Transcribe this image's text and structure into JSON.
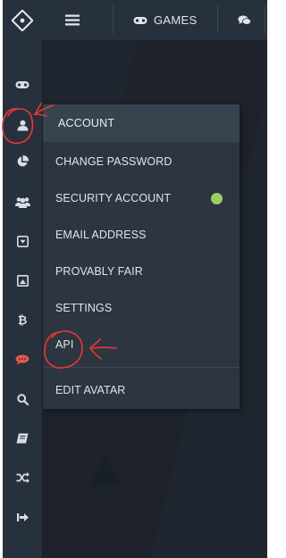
{
  "topbar": {
    "games_label": "GAMES"
  },
  "sidebar": {
    "icons": [
      "logo-icon",
      "gamepad-icon",
      "user-icon",
      "pie-chart-icon",
      "users-icon",
      "caret-square-down-icon",
      "image-icon",
      "bitcoin-icon",
      "chat-icon",
      "search-icon",
      "book-icon",
      "shuffle-icon",
      "sign-out-icon"
    ]
  },
  "menu": {
    "header": "ACCOUNT",
    "items": [
      {
        "label": "CHANGE PASSWORD"
      },
      {
        "label": "SECURITY ACCOUNT"
      },
      {
        "label": "EMAIL ADDRESS"
      },
      {
        "label": "PROVABLY FAIR"
      },
      {
        "label": "SETTINGS"
      },
      {
        "label": "API"
      },
      {
        "label": "EDIT AVATAR"
      }
    ]
  },
  "colors": {
    "sidebar": "#27313d",
    "background": "#1f252e",
    "menu": "#2c3540",
    "menu_header": "#37434f",
    "status_dot": "#9ccc65",
    "annotation": "#e53935"
  }
}
